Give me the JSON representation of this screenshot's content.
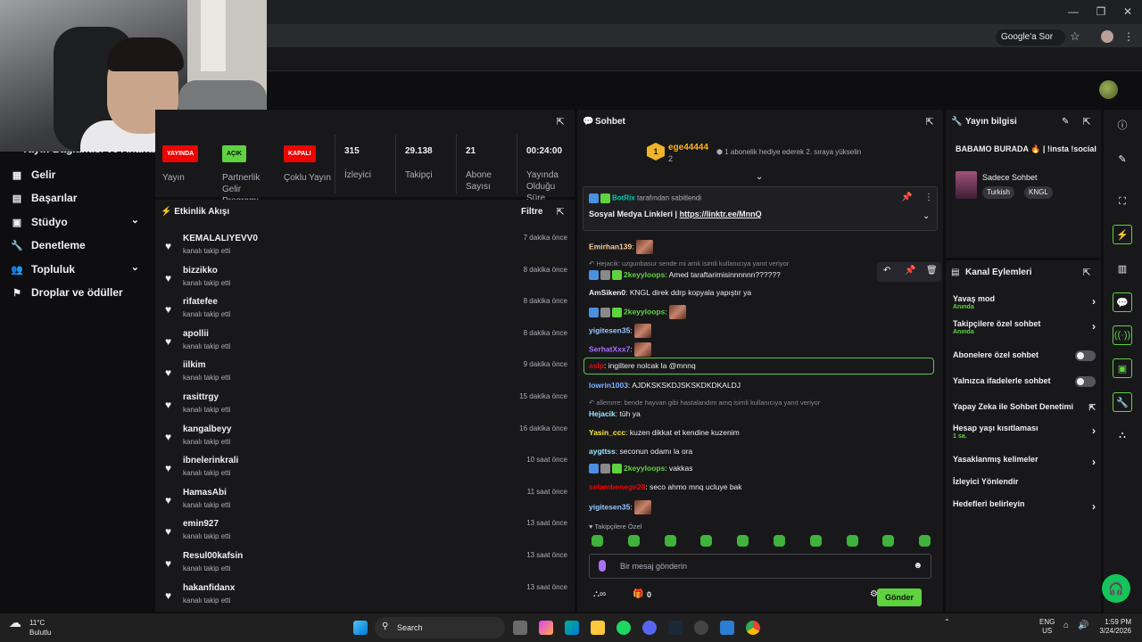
{
  "browser": {
    "google_button": "Google'a Sor",
    "star": "☆",
    "menu": "⋮",
    "minimize": "—",
    "maximize": "❐",
    "close": "✕"
  },
  "sidebar": {
    "section_title": "Yayın Bağlantısı ve Anahtarı",
    "items": [
      {
        "label": "Gelir",
        "icon": "revenue-icon"
      },
      {
        "label": "Başarılar",
        "icon": "achievements-icon"
      },
      {
        "label": "Stüdyo",
        "icon": "studio-icon",
        "expandable": true
      },
      {
        "label": "Denetleme",
        "icon": "moderation-icon"
      },
      {
        "label": "Topluluk",
        "icon": "community-icon",
        "expandable": true
      },
      {
        "label": "Droplar ve ödüller",
        "icon": "drops-icon"
      }
    ]
  },
  "stats": [
    {
      "badge": "YAYINDA",
      "label": "Yayın",
      "badge_color": "#eb0400"
    },
    {
      "badge": "AÇIK",
      "label": "Partnerlik Gelir Programı",
      "badge_color": "#5fd33f"
    },
    {
      "badge": "KAPALI",
      "label": "Çoklu Yayın",
      "badge_color": "#eb0400"
    },
    {
      "value": "315",
      "label": "İzleyici"
    },
    {
      "value": "29.138",
      "label": "Takipçi"
    },
    {
      "value": "21",
      "label": "Abone Sayısı"
    },
    {
      "value": "00:24:00",
      "label": "Yayında Olduğu Süre"
    }
  ],
  "activity": {
    "title": "Etkinlik Akışı",
    "filter": "Filtre",
    "events": [
      {
        "name": "KEMALALIYEVV0",
        "action": "kanalı takip etti",
        "time": "7 dakika önce"
      },
      {
        "name": "bizzikko",
        "action": "kanalı takip etti",
        "time": "8 dakika önce"
      },
      {
        "name": "rifatefee",
        "action": "kanalı takip etti",
        "time": "8 dakika önce"
      },
      {
        "name": "apollii",
        "action": "kanalı takip etti",
        "time": "8 dakika önce"
      },
      {
        "name": "iilkim",
        "action": "kanalı takip etti",
        "time": "9 dakika önce"
      },
      {
        "name": "rasittrgy",
        "action": "kanalı takip etti",
        "time": "15 dakika önce"
      },
      {
        "name": "kangalbeyy",
        "action": "kanalı takip etti",
        "time": "16 dakika önce"
      },
      {
        "name": "ibnelerinkrali",
        "action": "kanalı takip etti",
        "time": "10 saat önce"
      },
      {
        "name": "HamasAbi",
        "action": "kanalı takip etti",
        "time": "11 saat önce"
      },
      {
        "name": "emin927",
        "action": "kanalı takip etti",
        "time": "13 saat önce"
      },
      {
        "name": "Resul00kafsin",
        "action": "kanalı takip etti",
        "time": "13 saat önce"
      },
      {
        "name": "hakanfidanx",
        "action": "kanalı takip etti",
        "time": "13 saat önce"
      }
    ]
  },
  "chat": {
    "title": "Sohbet",
    "gift": {
      "rank": "1",
      "user": "ege44444",
      "count": "2",
      "message": "1 abonelik hediye ederek 2. sıraya yükselin"
    },
    "pinned": {
      "by": "BotRix",
      "by_suffix": "tarafından sabitlendi",
      "prefix": "Sosyal Medya Linkleri |",
      "link": "https://linktr.ee/MnnQ"
    },
    "messages": [
      {
        "type": "msg",
        "user": "Emirhan139",
        "color": "#ffcf9a",
        "text": "",
        "emote": true
      },
      {
        "type": "reply",
        "text": "Hejacik: uzgunbasur sende mi amk isimli kullanıcıya yanıt veriyor"
      },
      {
        "type": "msg",
        "user": "2keyyloops",
        "color": "#5fd33f",
        "text": "Amed taraftarimisinnnnnn??????",
        "badges": true
      },
      {
        "type": "msg",
        "user": "AmSiken0",
        "color": "#efeff1",
        "text": "KNGL direk ddrp kopyala yapıştır ya"
      },
      {
        "type": "msg",
        "user": "2keyyloops",
        "color": "#5fd33f",
        "text": "",
        "badges": true,
        "emote": true
      },
      {
        "type": "msg",
        "user": "yigitesen35",
        "color": "#9ac7ff",
        "text": "",
        "emote": true
      },
      {
        "type": "msg",
        "user": "SerhatXxx7",
        "color": "#a970ff",
        "text": "",
        "emote": true
      },
      {
        "type": "msg",
        "user": "aslp",
        "color": "#eb0400",
        "text": "ingiltere nolcak la @mnnq",
        "highlight": true
      },
      {
        "type": "msg",
        "user": "lowrin1003",
        "color": "#7fb2ff",
        "text": "AJDKSKSKDJSKSKDKDKALDJ"
      },
      {
        "type": "reply",
        "text": "allemrre: bende hayvan gibi hastalandım amq isimli kullanıcıya yanıt veriyor"
      },
      {
        "type": "msg",
        "user": "Hejacik",
        "color": "#9ae6ff",
        "text": "tüh ya"
      },
      {
        "type": "msg",
        "user": "Yasin_ccc",
        "color": "#ffeb3b",
        "text": "kuzen dikkat et kendine kuzenim"
      },
      {
        "type": "msg",
        "user": "aygttss",
        "color": "#9ae6ff",
        "text": "seconun odamı la ora"
      },
      {
        "type": "msg",
        "user": "2keyyloops",
        "color": "#5fd33f",
        "text": "vakkas",
        "badges": true
      },
      {
        "type": "msg",
        "user": "selambenege28",
        "color": "#eb0400",
        "text": "seco ahmo mnq ucluye bak"
      },
      {
        "type": "msg",
        "user": "yigitesen35",
        "color": "#9ac7ff",
        "text": "",
        "emote": true
      }
    ],
    "followers_only": "Takipçilere Özel",
    "input_placeholder": "Bir mesaj gönderin",
    "points": "0",
    "send": "Gönder"
  },
  "stream_info": {
    "title": "Yayın bilgisi",
    "stream_title": "BABAMO BURADA 🔥 | !insta !social",
    "category": "Sadece Sohbet",
    "tags": [
      "Turkish",
      "KNGL"
    ]
  },
  "channel_actions": {
    "title": "Kanal Eylemleri",
    "items": [
      {
        "label": "Yavaş mod",
        "sub": "Anında",
        "control": "chevron"
      },
      {
        "label": "Takipçilere özel sohbet",
        "sub": "Anında",
        "control": "chevron"
      },
      {
        "label": "Abonelere özel sohbet",
        "control": "toggle"
      },
      {
        "label": "Yalnızca ifadelerle sohbet",
        "control": "toggle"
      },
      {
        "label": "Yapay Zeka ile Sohbet Denetimi",
        "control": "external"
      },
      {
        "label": "Hesap yaşı kısıtlaması",
        "sub": "1 sa.",
        "control": "chevron"
      },
      {
        "label": "Yasaklanmış kelimeler",
        "control": "chevron"
      },
      {
        "label": "İzleyici Yönlendir",
        "control": "none"
      },
      {
        "label": "Hedefleri belirleyin",
        "control": "chevron"
      }
    ]
  },
  "taskbar": {
    "weather_temp": "11°C",
    "weather_desc": "Bulutlu",
    "search": "Search",
    "lang": "ENG",
    "region": "US",
    "time": "1:59 PM",
    "date": "3/24/2026"
  },
  "colors": {
    "accent": "#5fd33f",
    "live": "#eb0400"
  }
}
